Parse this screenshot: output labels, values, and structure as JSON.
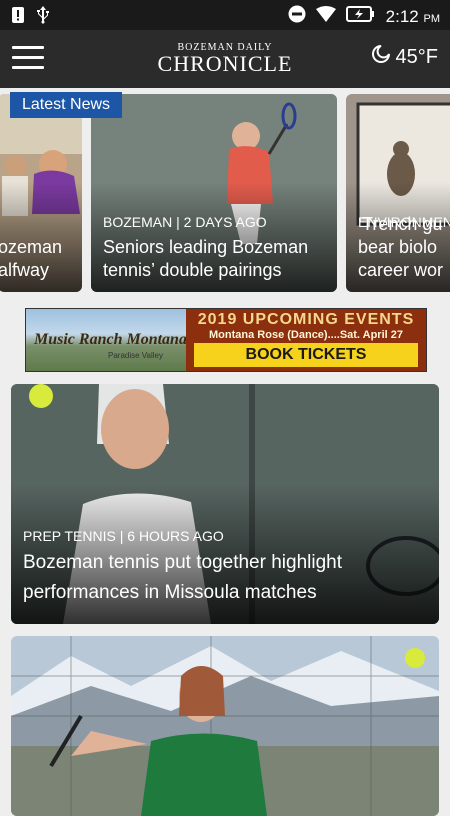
{
  "status_bar": {
    "time": "2:12",
    "ampm": "PM"
  },
  "app_bar": {
    "brand_top": "BOZEMAN DAILY",
    "brand_main": "CHRONICLE",
    "weather": "45°F"
  },
  "carousel": {
    "badge": "Latest News",
    "cards": [
      {
        "kicker": "",
        "headline": "ozeman\nalfway"
      },
      {
        "kicker": "BOZEMAN | 2 DAYS AGO",
        "headline": "Seniors leading Bozeman tennis’ double pairings"
      },
      {
        "kicker": "ENVIRONMENT",
        "headline": "‘Trench gu\nbear biolo\ncareer wor"
      }
    ]
  },
  "ad": {
    "logo": "Music Ranch Montana",
    "sub": "Paradise Valley",
    "title": "2019 UPCOMING EVENTS",
    "detail": "Montana Rose (Dance)....Sat. April 27",
    "cta": "BOOK TICKETS"
  },
  "stories": [
    {
      "kicker": "PREP TENNIS | 6 HOURS AGO",
      "headline": "Bozeman tennis put together highlight performances in Missoula matches"
    },
    {
      "kicker": "",
      "headline": ""
    }
  ],
  "colors": {
    "badge": "#1d56a6",
    "appbar": "#2b2b2b",
    "statusbar": "#1a1a1a",
    "ad_cta": "#f7d21d"
  }
}
